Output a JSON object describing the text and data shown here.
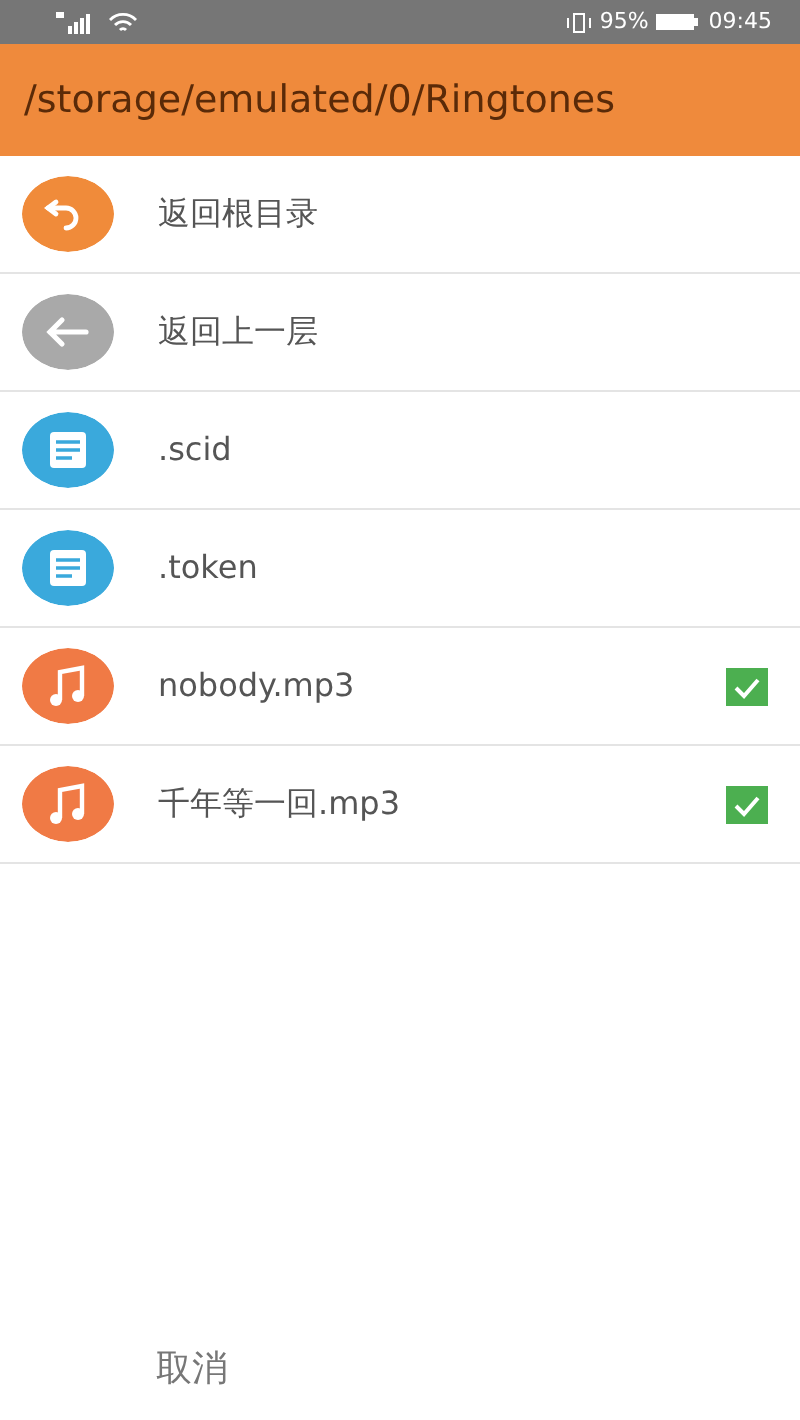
{
  "status_bar": {
    "battery": "95%",
    "time": "09:45"
  },
  "header": {
    "title": "/storage/emulated/0/Ringtones"
  },
  "items": [
    {
      "kind": "root",
      "label": "返回根目录"
    },
    {
      "kind": "up",
      "label": "返回上一层"
    },
    {
      "kind": "file",
      "label": ".scid"
    },
    {
      "kind": "file",
      "label": ".token"
    },
    {
      "kind": "audio",
      "label": "nobody.mp3",
      "checked": true
    },
    {
      "kind": "audio",
      "label": "千年等一回.mp3",
      "checked": true
    }
  ],
  "footer": {
    "cancel": "取消"
  }
}
